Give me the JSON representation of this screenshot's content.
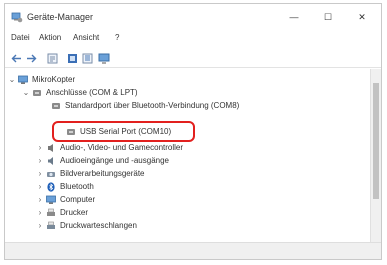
{
  "window": {
    "title": "Geräte-Manager",
    "controls": {
      "minimize": "—",
      "maximize": "☐",
      "close": "✕"
    }
  },
  "menu": {
    "items": [
      "Datei",
      "Aktion",
      "Ansicht",
      "?"
    ]
  },
  "toolbar": {
    "buttons": [
      "back-arrow-icon",
      "forward-arrow-icon",
      "properties-icon",
      "update-driver-icon",
      "help-icon",
      "monitor-icon"
    ]
  },
  "tree": {
    "root": "MikroKopter",
    "ports_category": "Anschlüsse (COM & LPT)",
    "ports_children": [
      "Standardport über Bluetooth-Verbindung (COM8)",
      "USB Serial Port (COM10)"
    ],
    "categories": [
      "Audio-, Video- und Gamecontroller",
      "Audioeingänge und -ausgänge",
      "Bildverarbeitungsgeräte",
      "Bluetooth",
      "Computer",
      "Drucker",
      "Druckwarteschlangen"
    ]
  },
  "highlight_color": "#e2201e"
}
